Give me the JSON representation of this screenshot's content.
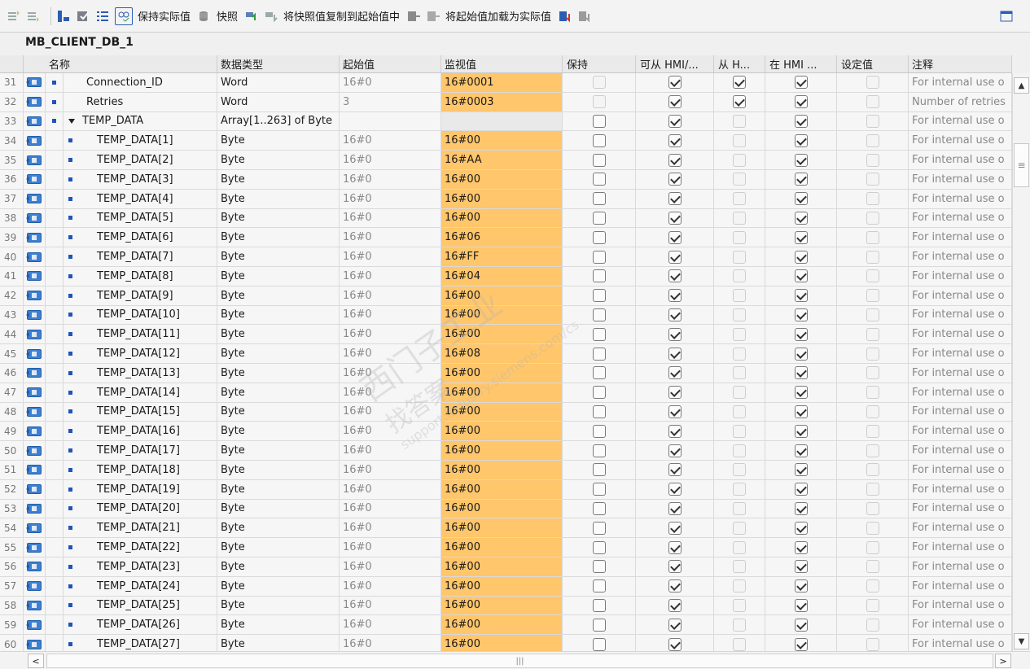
{
  "toolbar": {
    "keep_actual": "保持实际值",
    "snapshot": "快照",
    "copy_snapshot": "将快照值复制到起始值中",
    "load_start": "将起始值加载为实际值"
  },
  "db_title": "MB_CLIENT_DB_1",
  "headers": {
    "name": "名称",
    "datatype": "数据类型",
    "start": "起始值",
    "monitor": "监视值",
    "retain": "保持",
    "hmi_access": "可从 HMI/...",
    "from_hmi": "从 H...",
    "in_hmi": "在 HMI ...",
    "setpoint": "设定值",
    "comment": "注释"
  },
  "rows": [
    {
      "n": "31",
      "name": "Connection_ID",
      "type": "Word",
      "start": "16#0",
      "mon": "16#0001",
      "retain": false,
      "retainDis": true,
      "hmi": true,
      "fromh": true,
      "inhmi": true,
      "sp": false,
      "comment": "For internal use o",
      "indent": 1,
      "top": true
    },
    {
      "n": "32",
      "name": "Retries",
      "type": "Word",
      "start": "3",
      "mon": "16#0003",
      "retain": false,
      "retainDis": true,
      "hmi": true,
      "fromh": true,
      "inhmi": true,
      "sp": false,
      "comment": "Number of retries",
      "indent": 1,
      "top": true
    },
    {
      "n": "33",
      "name": "TEMP_DATA",
      "type": "Array[1..263] of Byte",
      "start": "",
      "mon": "",
      "retain": false,
      "retainDis": false,
      "hmi": true,
      "fromh": false,
      "inhmi": true,
      "sp": false,
      "comment": "For internal use o",
      "indent": 1,
      "top": true,
      "expand": true
    },
    {
      "n": "34",
      "name": "TEMP_DATA[1]",
      "type": "Byte",
      "start": "16#0",
      "mon": "16#00",
      "retain": false,
      "hmi": true,
      "fromh": false,
      "inhmi": true,
      "sp": false,
      "comment": "For internal use o",
      "indent": 2
    },
    {
      "n": "35",
      "name": "TEMP_DATA[2]",
      "type": "Byte",
      "start": "16#0",
      "mon": "16#AA",
      "retain": false,
      "hmi": true,
      "fromh": false,
      "inhmi": true,
      "sp": false,
      "comment": "For internal use o",
      "indent": 2
    },
    {
      "n": "36",
      "name": "TEMP_DATA[3]",
      "type": "Byte",
      "start": "16#0",
      "mon": "16#00",
      "retain": false,
      "hmi": true,
      "fromh": false,
      "inhmi": true,
      "sp": false,
      "comment": "For internal use o",
      "indent": 2
    },
    {
      "n": "37",
      "name": "TEMP_DATA[4]",
      "type": "Byte",
      "start": "16#0",
      "mon": "16#00",
      "retain": false,
      "hmi": true,
      "fromh": false,
      "inhmi": true,
      "sp": false,
      "comment": "For internal use o",
      "indent": 2
    },
    {
      "n": "38",
      "name": "TEMP_DATA[5]",
      "type": "Byte",
      "start": "16#0",
      "mon": "16#00",
      "retain": false,
      "hmi": true,
      "fromh": false,
      "inhmi": true,
      "sp": false,
      "comment": "For internal use o",
      "indent": 2
    },
    {
      "n": "39",
      "name": "TEMP_DATA[6]",
      "type": "Byte",
      "start": "16#0",
      "mon": "16#06",
      "retain": false,
      "hmi": true,
      "fromh": false,
      "inhmi": true,
      "sp": false,
      "comment": "For internal use o",
      "indent": 2
    },
    {
      "n": "40",
      "name": "TEMP_DATA[7]",
      "type": "Byte",
      "start": "16#0",
      "mon": "16#FF",
      "retain": false,
      "hmi": true,
      "fromh": false,
      "inhmi": true,
      "sp": false,
      "comment": "For internal use o",
      "indent": 2
    },
    {
      "n": "41",
      "name": "TEMP_DATA[8]",
      "type": "Byte",
      "start": "16#0",
      "mon": "16#04",
      "retain": false,
      "hmi": true,
      "fromh": false,
      "inhmi": true,
      "sp": false,
      "comment": "For internal use o",
      "indent": 2
    },
    {
      "n": "42",
      "name": "TEMP_DATA[9]",
      "type": "Byte",
      "start": "16#0",
      "mon": "16#00",
      "retain": false,
      "hmi": true,
      "fromh": false,
      "inhmi": true,
      "sp": false,
      "comment": "For internal use o",
      "indent": 2
    },
    {
      "n": "43",
      "name": "TEMP_DATA[10]",
      "type": "Byte",
      "start": "16#0",
      "mon": "16#00",
      "retain": false,
      "hmi": true,
      "fromh": false,
      "inhmi": true,
      "sp": false,
      "comment": "For internal use o",
      "indent": 2
    },
    {
      "n": "44",
      "name": "TEMP_DATA[11]",
      "type": "Byte",
      "start": "16#0",
      "mon": "16#00",
      "retain": false,
      "hmi": true,
      "fromh": false,
      "inhmi": true,
      "sp": false,
      "comment": "For internal use o",
      "indent": 2
    },
    {
      "n": "45",
      "name": "TEMP_DATA[12]",
      "type": "Byte",
      "start": "16#0",
      "mon": "16#08",
      "retain": false,
      "hmi": true,
      "fromh": false,
      "inhmi": true,
      "sp": false,
      "comment": "For internal use o",
      "indent": 2
    },
    {
      "n": "46",
      "name": "TEMP_DATA[13]",
      "type": "Byte",
      "start": "16#0",
      "mon": "16#00",
      "retain": false,
      "hmi": true,
      "fromh": false,
      "inhmi": true,
      "sp": false,
      "comment": "For internal use o",
      "indent": 2
    },
    {
      "n": "47",
      "name": "TEMP_DATA[14]",
      "type": "Byte",
      "start": "16#0",
      "mon": "16#00",
      "retain": false,
      "hmi": true,
      "fromh": false,
      "inhmi": true,
      "sp": false,
      "comment": "For internal use o",
      "indent": 2
    },
    {
      "n": "48",
      "name": "TEMP_DATA[15]",
      "type": "Byte",
      "start": "16#0",
      "mon": "16#00",
      "retain": false,
      "hmi": true,
      "fromh": false,
      "inhmi": true,
      "sp": false,
      "comment": "For internal use o",
      "indent": 2
    },
    {
      "n": "49",
      "name": "TEMP_DATA[16]",
      "type": "Byte",
      "start": "16#0",
      "mon": "16#00",
      "retain": false,
      "hmi": true,
      "fromh": false,
      "inhmi": true,
      "sp": false,
      "comment": "For internal use o",
      "indent": 2
    },
    {
      "n": "50",
      "name": "TEMP_DATA[17]",
      "type": "Byte",
      "start": "16#0",
      "mon": "16#00",
      "retain": false,
      "hmi": true,
      "fromh": false,
      "inhmi": true,
      "sp": false,
      "comment": "For internal use o",
      "indent": 2
    },
    {
      "n": "51",
      "name": "TEMP_DATA[18]",
      "type": "Byte",
      "start": "16#0",
      "mon": "16#00",
      "retain": false,
      "hmi": true,
      "fromh": false,
      "inhmi": true,
      "sp": false,
      "comment": "For internal use o",
      "indent": 2
    },
    {
      "n": "52",
      "name": "TEMP_DATA[19]",
      "type": "Byte",
      "start": "16#0",
      "mon": "16#00",
      "retain": false,
      "hmi": true,
      "fromh": false,
      "inhmi": true,
      "sp": false,
      "comment": "For internal use o",
      "indent": 2
    },
    {
      "n": "53",
      "name": "TEMP_DATA[20]",
      "type": "Byte",
      "start": "16#0",
      "mon": "16#00",
      "retain": false,
      "hmi": true,
      "fromh": false,
      "inhmi": true,
      "sp": false,
      "comment": "For internal use o",
      "indent": 2
    },
    {
      "n": "54",
      "name": "TEMP_DATA[21]",
      "type": "Byte",
      "start": "16#0",
      "mon": "16#00",
      "retain": false,
      "hmi": true,
      "fromh": false,
      "inhmi": true,
      "sp": false,
      "comment": "For internal use o",
      "indent": 2
    },
    {
      "n": "55",
      "name": "TEMP_DATA[22]",
      "type": "Byte",
      "start": "16#0",
      "mon": "16#00",
      "retain": false,
      "hmi": true,
      "fromh": false,
      "inhmi": true,
      "sp": false,
      "comment": "For internal use o",
      "indent": 2
    },
    {
      "n": "56",
      "name": "TEMP_DATA[23]",
      "type": "Byte",
      "start": "16#0",
      "mon": "16#00",
      "retain": false,
      "hmi": true,
      "fromh": false,
      "inhmi": true,
      "sp": false,
      "comment": "For internal use o",
      "indent": 2
    },
    {
      "n": "57",
      "name": "TEMP_DATA[24]",
      "type": "Byte",
      "start": "16#0",
      "mon": "16#00",
      "retain": false,
      "hmi": true,
      "fromh": false,
      "inhmi": true,
      "sp": false,
      "comment": "For internal use o",
      "indent": 2
    },
    {
      "n": "58",
      "name": "TEMP_DATA[25]",
      "type": "Byte",
      "start": "16#0",
      "mon": "16#00",
      "retain": false,
      "hmi": true,
      "fromh": false,
      "inhmi": true,
      "sp": false,
      "comment": "For internal use o",
      "indent": 2
    },
    {
      "n": "59",
      "name": "TEMP_DATA[26]",
      "type": "Byte",
      "start": "16#0",
      "mon": "16#00",
      "retain": false,
      "hmi": true,
      "fromh": false,
      "inhmi": true,
      "sp": false,
      "comment": "For internal use o",
      "indent": 2
    },
    {
      "n": "60",
      "name": "TEMP_DATA[27]",
      "type": "Byte",
      "start": "16#0",
      "mon": "16#00",
      "retain": false,
      "hmi": true,
      "fromh": false,
      "inhmi": true,
      "sp": false,
      "comment": "For internal use o",
      "indent": 2
    }
  ],
  "watermark": {
    "line1": "西门子工业",
    "line2": "找答案",
    "line3": "support.industry.siemens.com/cs"
  },
  "colors": {
    "monitor_bg": "#ffc66b",
    "icon_blue": "#2253b8"
  }
}
